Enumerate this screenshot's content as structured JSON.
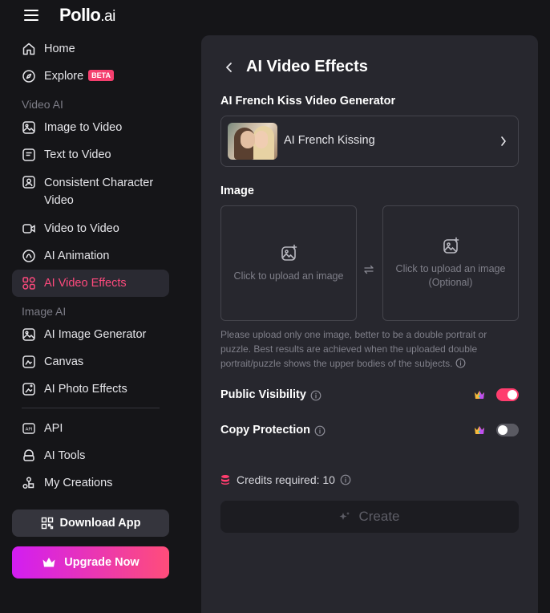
{
  "brand": {
    "logo_main": "Pollo",
    "logo_suffix": ".ai"
  },
  "sidebar": {
    "items_top": [
      {
        "label": "Home",
        "icon": "home-icon"
      },
      {
        "label": "Explore",
        "icon": "compass-icon",
        "badge": "BETA"
      }
    ],
    "section_video": "Video AI",
    "items_video": [
      {
        "label": "Image to Video",
        "icon": "image-video-icon"
      },
      {
        "label": "Text to Video",
        "icon": "text-video-icon"
      },
      {
        "label": "Consistent Character Video",
        "icon": "character-icon"
      },
      {
        "label": "Video to Video",
        "icon": "video-video-icon"
      },
      {
        "label": "AI Animation",
        "icon": "animation-icon"
      },
      {
        "label": "AI Video Effects",
        "icon": "effects-icon",
        "active": true
      }
    ],
    "section_image": "Image AI",
    "items_image": [
      {
        "label": "AI Image Generator",
        "icon": "image-gen-icon"
      },
      {
        "label": "Canvas",
        "icon": "canvas-icon"
      },
      {
        "label": "AI Photo Effects",
        "icon": "photo-effects-icon"
      }
    ],
    "items_bottom": [
      {
        "label": "API",
        "icon": "api-icon"
      },
      {
        "label": "AI Tools",
        "icon": "tools-icon"
      },
      {
        "label": "My Creations",
        "icon": "creations-icon"
      }
    ],
    "download_label": "Download App",
    "upgrade_label": "Upgrade Now"
  },
  "main": {
    "title": "AI Video Effects",
    "generator_title": "AI French Kiss Video Generator",
    "effect_name": "AI French Kissing",
    "image_label": "Image",
    "upload_primary": "Click to upload an image",
    "upload_secondary": "Click to upload an image",
    "upload_secondary_note": "(Optional)",
    "hint": "Please upload only one image, better to be a double portrait or puzzle. Best results are achieved when the uploaded double portrait/puzzle shows the upper bodies of the subjects.",
    "public_visibility_label": "Public Visibility",
    "public_visibility_on": true,
    "copy_protection_label": "Copy Protection",
    "copy_protection_on": false,
    "credits_label": "Credits required: 10",
    "create_label": "Create"
  },
  "colors": {
    "accent": "#ff3d6e",
    "panel": "#27272e",
    "background": "#151518",
    "upgrade_gradient_start": "#d21df2",
    "upgrade_gradient_end": "#ff4d7a"
  }
}
